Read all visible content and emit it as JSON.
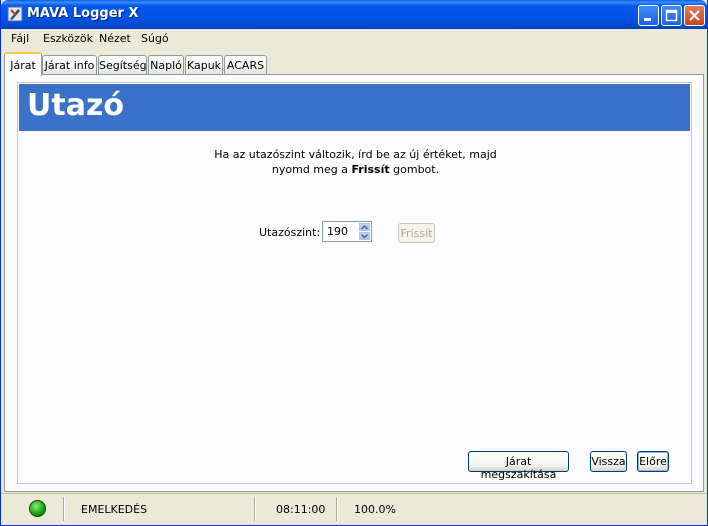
{
  "window": {
    "title": "MAVA Logger X"
  },
  "menu": [
    "Fájl",
    "Eszközök",
    "Nézet",
    "Súgó"
  ],
  "tabs": [
    "Járat",
    "Járat info",
    "Segítség",
    "Napló",
    "Kapuk",
    "ACARS"
  ],
  "active_tab": "Járat",
  "page": {
    "title": "Utazó",
    "instruction_line1": "Ha az utazószint változik, írd be az új értéket, majd",
    "instruction_line2_pre": "nyomd meg a ",
    "instruction_line2_bold": "Frissít",
    "instruction_line2_post": " gombot.",
    "field_label": "Utazószint:",
    "field_value": "190",
    "refresh_label": "Frissít",
    "abort_label": "Járat megszakítása",
    "back_label": "Vissza",
    "next_label": "Előre"
  },
  "status": {
    "phase": "EMELKEDÉS",
    "time": "08:11:00",
    "percent": "100.0%",
    "led_color": "#1fa31a"
  }
}
